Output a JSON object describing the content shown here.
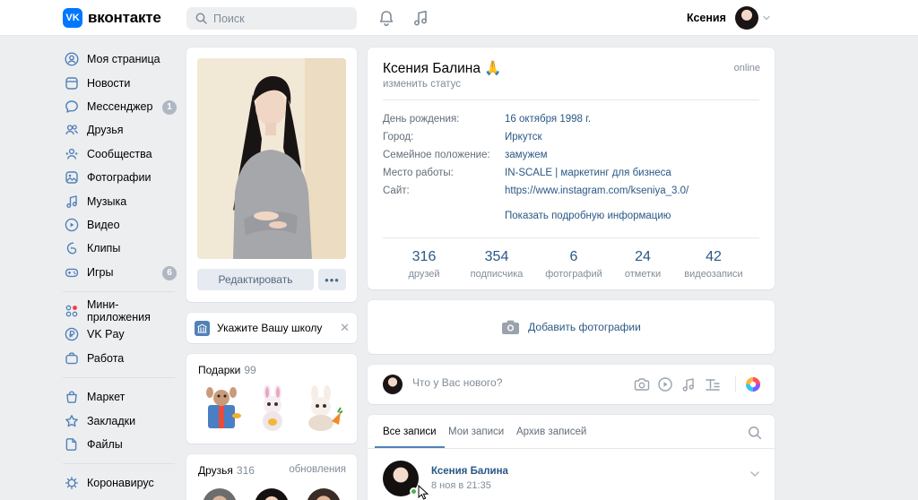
{
  "header": {
    "logo_mark": "VK",
    "logo_text": "вконтакте",
    "search_placeholder": "Поиск",
    "user_name": "Ксения"
  },
  "sidebar": {
    "items": [
      {
        "label": "Моя страница",
        "icon": "user-circle-icon"
      },
      {
        "label": "Новости",
        "icon": "newspaper-icon"
      },
      {
        "label": "Мессенджер",
        "icon": "chat-bubble-icon",
        "badge": "1"
      },
      {
        "label": "Друзья",
        "icon": "friends-icon"
      },
      {
        "label": "Сообщества",
        "icon": "community-icon"
      },
      {
        "label": "Фотографии",
        "icon": "photo-icon"
      },
      {
        "label": "Музыка",
        "icon": "music-note-icon"
      },
      {
        "label": "Видео",
        "icon": "play-circle-icon"
      },
      {
        "label": "Клипы",
        "icon": "clip-icon"
      },
      {
        "label": "Игры",
        "icon": "gamepad-icon",
        "badge": "6"
      }
    ],
    "items2": [
      {
        "label": "Мини-приложения",
        "icon": "apps-grid-icon"
      },
      {
        "label": "VK Pay",
        "icon": "vkpay-icon"
      },
      {
        "label": "Работа",
        "icon": "briefcase-icon"
      }
    ],
    "items3": [
      {
        "label": "Маркет",
        "icon": "shopping-bag-icon"
      },
      {
        "label": "Закладки",
        "icon": "star-icon"
      },
      {
        "label": "Файлы",
        "icon": "file-icon"
      }
    ],
    "items4": [
      {
        "label": "Коронавирус",
        "icon": "virus-icon"
      }
    ]
  },
  "profile": {
    "edit_label": "Редактировать",
    "more_label": "•••",
    "name": "Ксения Балина 🙏",
    "status_link": "изменить статус",
    "online": "online",
    "info": [
      {
        "key": "День рождения:",
        "value": "16 октября 1998 г."
      },
      {
        "key": "Город:",
        "value": "Иркутск"
      },
      {
        "key": "Семейное положение:",
        "value": "замужем"
      },
      {
        "key": "Место работы:",
        "value": "IN-SCALE | маркетинг для бизнеса"
      },
      {
        "key": "Сайт:",
        "value": "https://www.instagram.com/kseniya_3.0/"
      }
    ],
    "more_info": "Показать подробную информацию",
    "counters": [
      {
        "num": "316",
        "cap": "друзей"
      },
      {
        "num": "354",
        "cap": "подписчика"
      },
      {
        "num": "6",
        "cap": "фотографий"
      },
      {
        "num": "24",
        "cap": "отметки"
      },
      {
        "num": "42",
        "cap": "видеозаписи"
      }
    ]
  },
  "school": {
    "label": "Укажите Вашу школу"
  },
  "gifts": {
    "title": "Подарки",
    "count": "99"
  },
  "friends": {
    "title": "Друзья",
    "count": "316",
    "update": "обновления"
  },
  "add_photo": {
    "label": "Добавить фотографии"
  },
  "post": {
    "placeholder": "Что у Вас нового?"
  },
  "wall": {
    "tabs": [
      "Все записи",
      "Мои записи",
      "Архив записей"
    ],
    "entry": {
      "author": "Ксения Балина",
      "date": "8 ноя в 21:35"
    }
  },
  "colors": {
    "accent": "#5181b8",
    "link": "#2a5885",
    "brand": "#0077ff",
    "online": "#4bb34b"
  }
}
